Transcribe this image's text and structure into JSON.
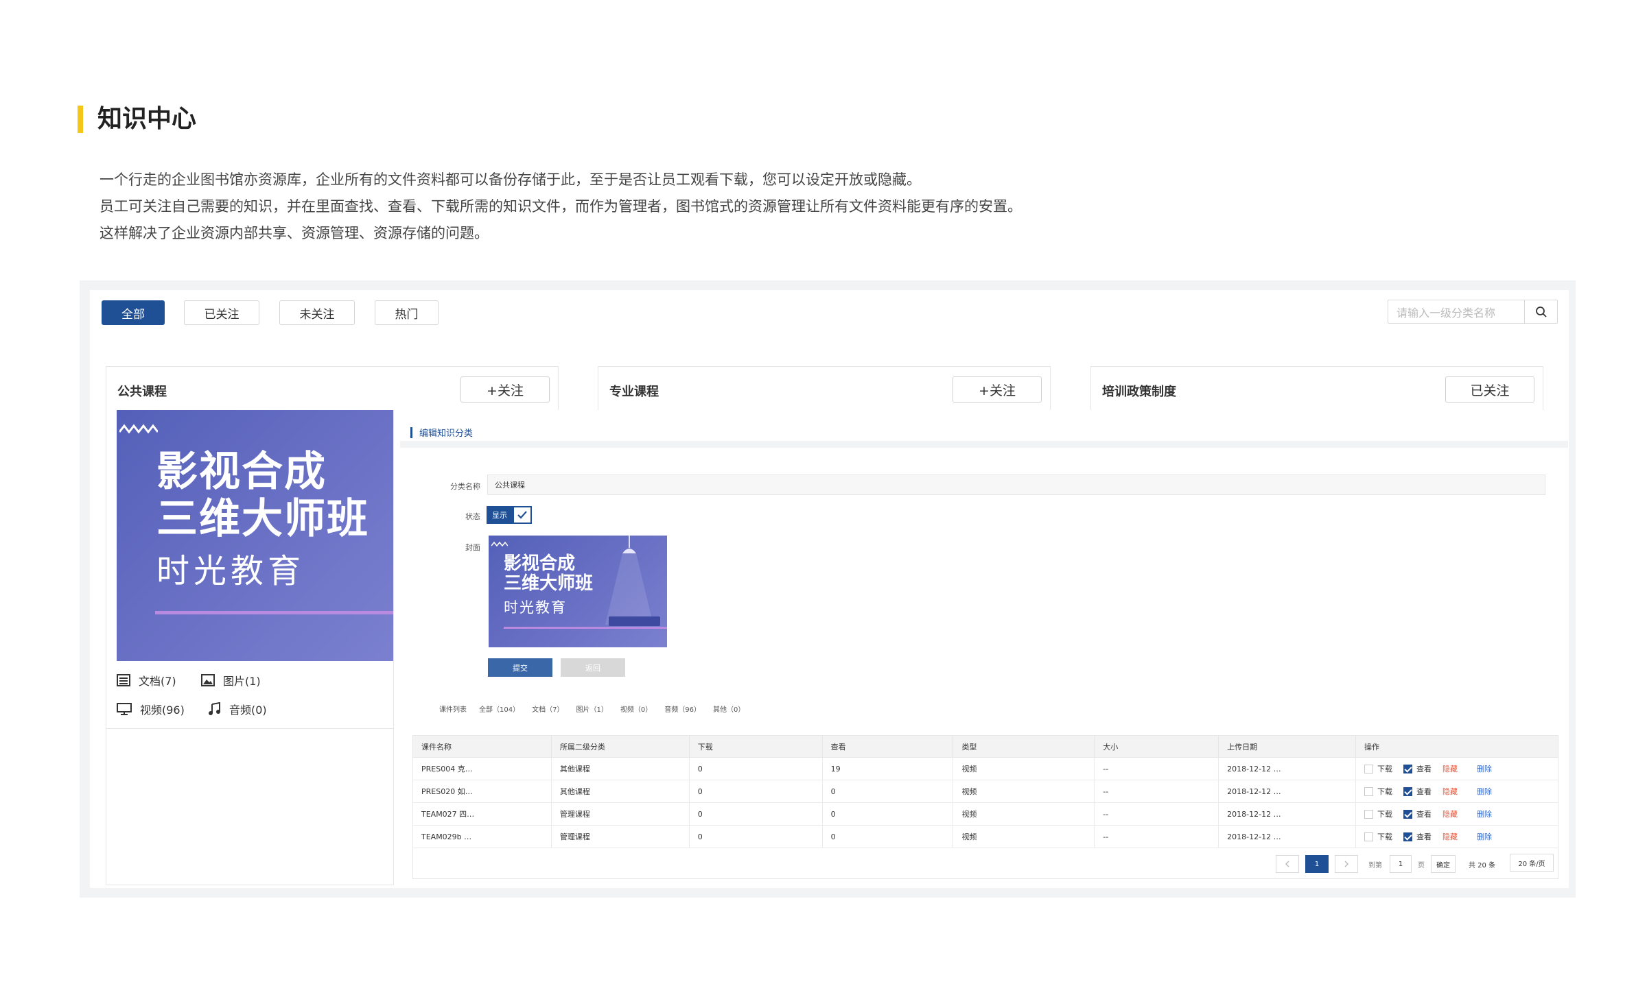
{
  "page": {
    "title": "知识中心",
    "description": [
      "一个行走的企业图书馆亦资源库，企业所有的文件资料都可以备份存储于此，至于是否让员工观看下载，您可以设定开放或隐藏。",
      "员工可关注自己需要的知识，并在里面查找、查看、下载所需的知识文件，而作为管理者，图书馆式的资源管理让所有文件资料能更有序的安置。",
      "这样解决了企业资源内部共享、资源管理、资源存储的问题。"
    ]
  },
  "filters": [
    "全部",
    "已关注",
    "未关注",
    "热门"
  ],
  "search": {
    "placeholder": "请输入一级分类名称"
  },
  "categories": [
    {
      "name": "公共课程",
      "follow": "+关注"
    },
    {
      "name": "专业课程",
      "follow": "+关注"
    },
    {
      "name": "培训政策制度",
      "follow": "已关注"
    }
  ],
  "cover": {
    "line1": "影视合成",
    "line2": "三维大师班",
    "line3": "时光教育"
  },
  "stats": {
    "docs": "文档(7)",
    "images": "图片(1)",
    "videos": "视频(96)",
    "audio": "音频(0)"
  },
  "editor": {
    "header": "编辑知识分类",
    "name_label": "分类名称",
    "name_value": "公共课程",
    "status_label": "状态",
    "status_value": "显示",
    "cover_label": "封面",
    "submit": "提交",
    "back": "返回"
  },
  "counts": [
    "课件列表",
    "全部（104）",
    "文档（7）",
    "图片（1）",
    "视频（0）",
    "音频（96）",
    "其他（0）"
  ],
  "table": {
    "headers": [
      "课件名称",
      "所属二级分类",
      "下载",
      "查看",
      "类型",
      "大小",
      "上传日期",
      "操作"
    ],
    "rows": [
      [
        "PRES004 克…",
        "其他课程",
        "0",
        "19",
        "视频",
        "--",
        "2018-12-12 …"
      ],
      [
        "PRES020 如…",
        "其他课程",
        "0",
        "0",
        "视频",
        "--",
        "2018-12-12 …"
      ],
      [
        "TEAM027 四…",
        "管理课程",
        "0",
        "0",
        "视频",
        "--",
        "2018-12-12 …"
      ],
      [
        "TEAM029b …",
        "管理课程",
        "0",
        "0",
        "视频",
        "--",
        "2018-12-12 …"
      ]
    ],
    "op_download": "下载",
    "op_view": "查看",
    "op_hide": "隐藏",
    "op_delete": "删除"
  },
  "pagination": {
    "current": "1",
    "goto_label": "到第",
    "page_input": "1",
    "page_unit": "页",
    "confirm": "确定",
    "total": "共 20 条",
    "page_size": "20 条/页"
  },
  "colors": {
    "accent": "#1f4f94",
    "title_bar": "#f5c518",
    "hide": "#e2563a",
    "delete": "#2f6bd4"
  }
}
